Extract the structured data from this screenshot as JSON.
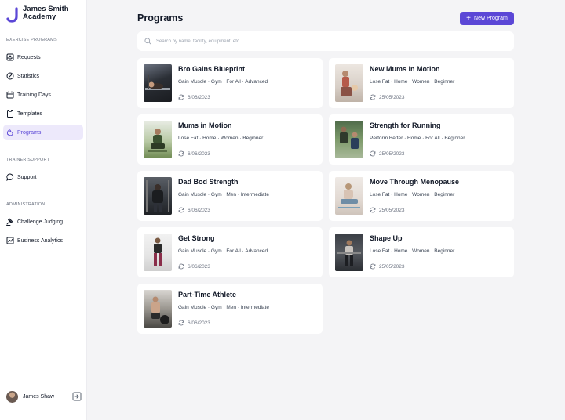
{
  "brand": {
    "line1": "James Smith",
    "line2": "Academy",
    "accent": "#5b47d6"
  },
  "sidebar": {
    "sections": {
      "exercise": "EXERCISE PROGRAMS",
      "trainer": "TRAINER SUPPORT",
      "admin": "ADMINISTRATION"
    },
    "items": [
      {
        "label": "Requests",
        "icon": "inbox-icon"
      },
      {
        "label": "Statistics",
        "icon": "gauge-icon"
      },
      {
        "label": "Training Days",
        "icon": "calendar-icon"
      },
      {
        "label": "Templates",
        "icon": "clipboard-icon"
      },
      {
        "label": "Programs",
        "icon": "dumbbell-arm-icon",
        "active": true
      },
      {
        "label": "Support",
        "icon": "chat-bubble-icon"
      },
      {
        "label": "Challenge Judging",
        "icon": "gavel-icon"
      },
      {
        "label": "Business Analytics",
        "icon": "chart-icon"
      }
    ],
    "user": {
      "name": "James Shaw"
    }
  },
  "main": {
    "title": "Programs",
    "new_button": "New Program",
    "search_placeholder": "Search by name, facility, equipment, etc."
  },
  "programs": [
    {
      "title": "Bro Gains Blueprint",
      "tags": "Gain Muscle · Gym · For All · Advanced",
      "date": "6/06/2023"
    },
    {
      "title": "New Mums in Motion",
      "tags": "Lose Fat · Home · Women · Beginner",
      "date": "25/05/2023"
    },
    {
      "title": "Mums in Motion",
      "tags": "Lose Fat · Home · Women · Beginner",
      "date": "6/06/2023"
    },
    {
      "title": "Strength for Running",
      "tags": "Perform Better · Home · For All · Beginner",
      "date": "25/05/2023"
    },
    {
      "title": "Dad Bod Strength",
      "tags": "Gain Muscle · Gym · Men · Intermediate",
      "date": "6/06/2023"
    },
    {
      "title": "Move Through Menopause",
      "tags": "Lose Fat · Home · Women · Beginner",
      "date": "25/05/2023"
    },
    {
      "title": "Get Strong",
      "tags": "Gain Muscle · Gym · For All · Advanced",
      "date": "6/06/2023"
    },
    {
      "title": "Shape Up",
      "tags": "Lose Fat · Home · Women · Beginner",
      "date": "25/05/2023"
    },
    {
      "title": "Part-Time Athlete",
      "tags": "Gain Muscle · Gym · Men · Intermediate",
      "date": "6/06/2023"
    }
  ]
}
